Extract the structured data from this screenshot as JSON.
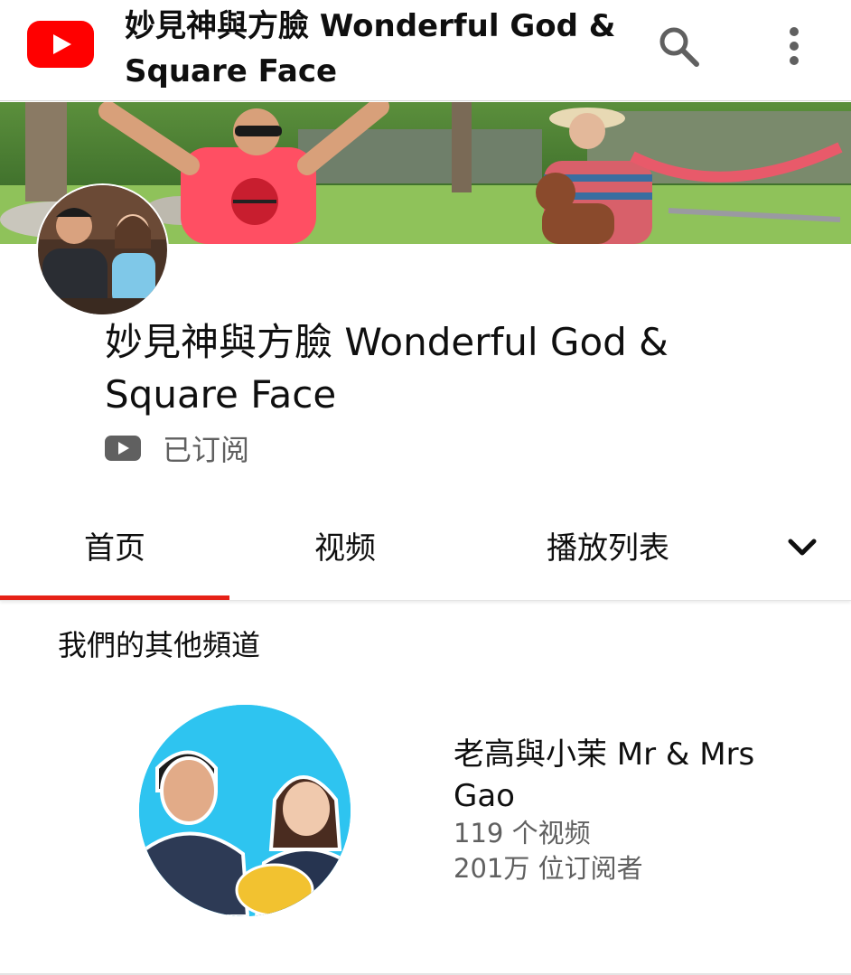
{
  "header": {
    "title": "妙見神與方臉 Wonderful God & Square Face",
    "logo_icon": "youtube-logo-icon",
    "search_icon": "search-icon",
    "more_icon": "more-vert-icon"
  },
  "channel": {
    "name": "妙見神與方臉 Wonderful God & Square Face",
    "subscribe_status": "已订阅",
    "subscribe_icon": "youtube-play-icon"
  },
  "tabs": [
    {
      "label": "首页",
      "selected": true
    },
    {
      "label": "视频",
      "selected": false
    },
    {
      "label": "播放列表",
      "selected": false
    }
  ],
  "tabs_more_icon": "chevron-down-icon",
  "other_channels": {
    "title": "我們的其他頻道",
    "items": [
      {
        "name": "老高與小茉 Mr & Mrs Gao",
        "videos": "119 个视频",
        "subscribers": "201万 位订阅者"
      }
    ]
  },
  "colors": {
    "brand_red": "#ff0000",
    "tab_indicator": "#e62117",
    "secondary_text": "#606060",
    "featured_avatar_bg": "#2ec4f0"
  }
}
